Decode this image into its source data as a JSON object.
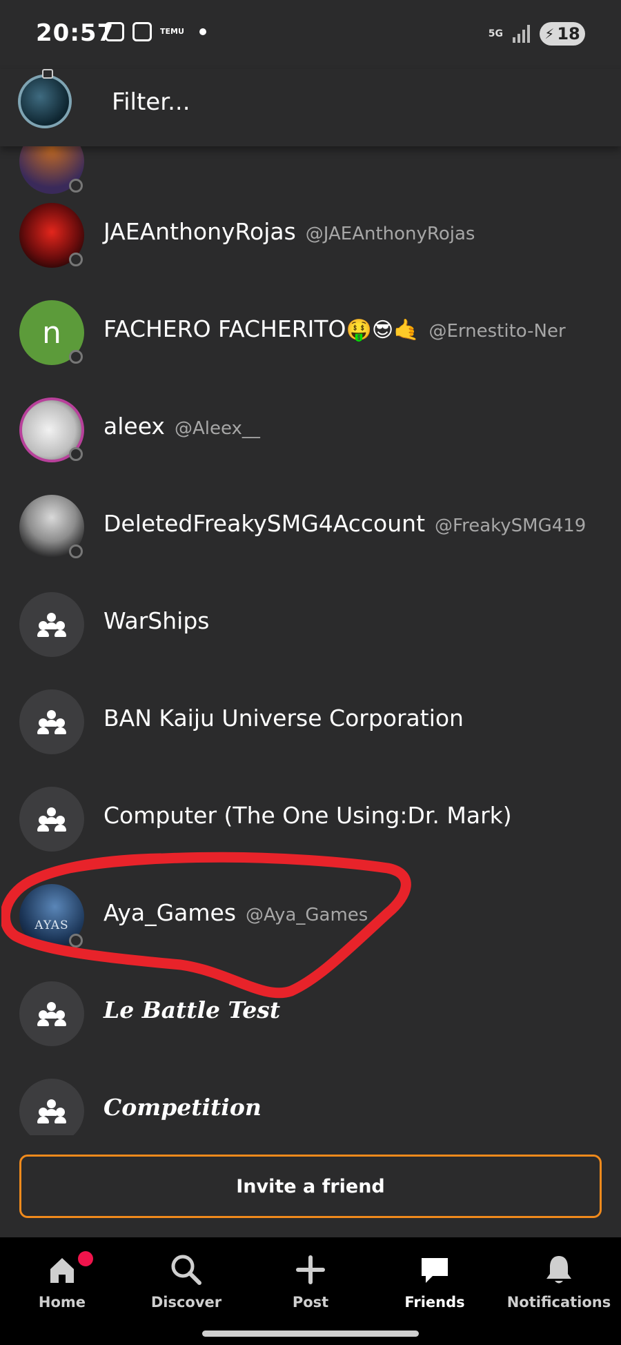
{
  "status_bar": {
    "time": "20:57",
    "temu_label": "TEMU",
    "network": "5G",
    "battery": "18"
  },
  "filter": {
    "placeholder": "Filter..."
  },
  "friends": [
    {
      "name": "",
      "handle": "",
      "avatar": "photo",
      "partial": true
    },
    {
      "name": "JAEAnthonyRojas",
      "handle": "@JAEAnthonyRojas",
      "avatar": "photo"
    },
    {
      "name": "FACHERO FACHERITO",
      "emoji": "🤑😎🤙",
      "handle": "@Ernestito-Ner",
      "avatar": "letter",
      "avatar_letter": "n",
      "avatar_color": "#5c9b3a"
    },
    {
      "name": "aleex",
      "handle": "@Aleex__",
      "avatar": "photo"
    },
    {
      "name": "DeletedFreakySMG4Account",
      "handle": "@FreakySMG419",
      "avatar": "photo"
    },
    {
      "name": "WarShips",
      "handle": "",
      "avatar": "group"
    },
    {
      "name": "BAN Kaiju Universe Corporation",
      "handle": "",
      "avatar": "group"
    },
    {
      "name": "Computer (The One Using:Dr. Mark)",
      "handle": "",
      "avatar": "group"
    },
    {
      "name": "Aya_Games",
      "handle": "@Aya_Games",
      "avatar": "photo",
      "avatar_text": "AYAS",
      "highlighted": true
    },
    {
      "name": "Le Battle Test",
      "handle": "",
      "avatar": "group",
      "style": "blackletter"
    },
    {
      "name": "Competition",
      "handle": "",
      "avatar": "group",
      "style": "blackletter"
    }
  ],
  "invite": {
    "label": "Invite a friend"
  },
  "nav": [
    {
      "label": "Home",
      "icon": "home-icon",
      "badge": true
    },
    {
      "label": "Discover",
      "icon": "search-icon"
    },
    {
      "label": "Post",
      "icon": "plus-icon"
    },
    {
      "label": "Friends",
      "icon": "chat-icon",
      "active": true
    },
    {
      "label": "Notifications",
      "icon": "bell-icon"
    }
  ],
  "colors": {
    "background": "#2b2b2c",
    "accent": "#f08a1c",
    "annotation": "#e8232a",
    "nav_bg": "#000000"
  }
}
